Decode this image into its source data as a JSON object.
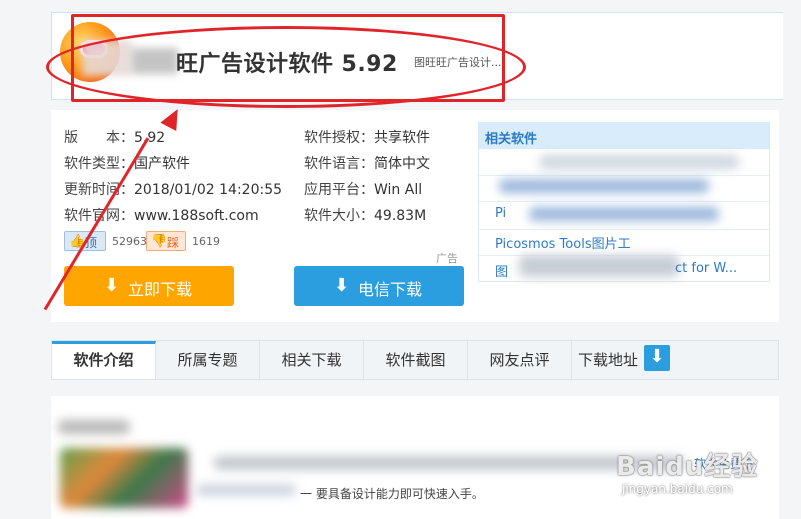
{
  "header": {
    "title": "旺广告设计软件",
    "version": "5.92",
    "subtitle": "图旺旺广告设计..."
  },
  "info": {
    "version_label": "版　　本：",
    "version_value": "5.92",
    "type_label": "软件类型：",
    "type_value": "国产软件",
    "updated_label": "更新时间：",
    "updated_value": "2018/01/02 14:20:55",
    "site_label": "软件官网：",
    "site_value": "www.188soft.com",
    "license_label": "软件授权：",
    "license_value": "共享软件",
    "language_label": "软件语言：",
    "language_value": "简体中文",
    "platform_label": "应用平台：",
    "platform_value": "Win All",
    "size_label": "软件大小：",
    "size_value": "49.83M"
  },
  "votes": {
    "like_label": "顶",
    "like_count": "52963",
    "dislike_label": "踩",
    "dislike_count": "1619"
  },
  "ad_label": "广告",
  "buttons": {
    "download": "立即下载",
    "telecom_download": "电信下载"
  },
  "related": {
    "heading": "相关软件",
    "items": [
      "Pi",
      "Picosmos Tools图片工",
      "图",
      "ct for W..."
    ]
  },
  "tabs": [
    "软件介绍",
    "所属专题",
    "相关下载",
    "软件截图",
    "网友点评",
    "下载地址"
  ],
  "content": {
    "description_tail": "一 要具备设计能力即可快速入手。",
    "more_link": "软件免费下"
  },
  "watermark": {
    "brand": "Baidu经验",
    "url": "jingyan.baidu.com"
  },
  "colors": {
    "accent_blue": "#2b9ee0",
    "download_orange": "#ffa500",
    "annotation_red": "#e0252a"
  }
}
